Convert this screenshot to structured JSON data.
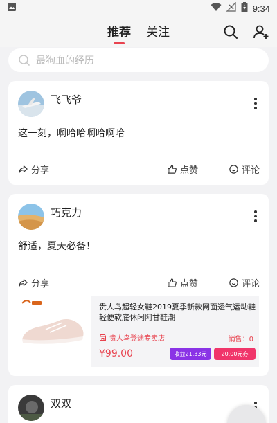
{
  "status_bar": {
    "time": "9:34"
  },
  "header": {
    "tabs": [
      {
        "label": "推荐",
        "active": true
      },
      {
        "label": "关注",
        "active": false
      }
    ]
  },
  "search": {
    "placeholder": "最狗血的经历"
  },
  "posts": [
    {
      "user": "飞飞爷",
      "text": "这一刻，啊哈哈啊哈啊哈",
      "actions": {
        "share": "分享",
        "like": "点赞",
        "comment": "评论"
      }
    },
    {
      "user": "巧克力",
      "text": "舒适，夏天必备！",
      "actions": {
        "share": "分享",
        "like": "点赞",
        "comment": "评论"
      },
      "product": {
        "title": "贵人鸟超轻女鞋2019夏季新款网面透气运动鞋轻便软底休闲阿甘鞋潮",
        "shop": "贵人鸟登途专卖店",
        "sales": "销售：0",
        "price": "¥99.00",
        "earn_tag": "收益21.33元",
        "coupon_tag": "20.00元券"
      }
    },
    {
      "user": "双双"
    }
  ],
  "colors": {
    "accent": "#e8434f",
    "earn": "#8a33e6",
    "coupon": "#f0356a"
  }
}
